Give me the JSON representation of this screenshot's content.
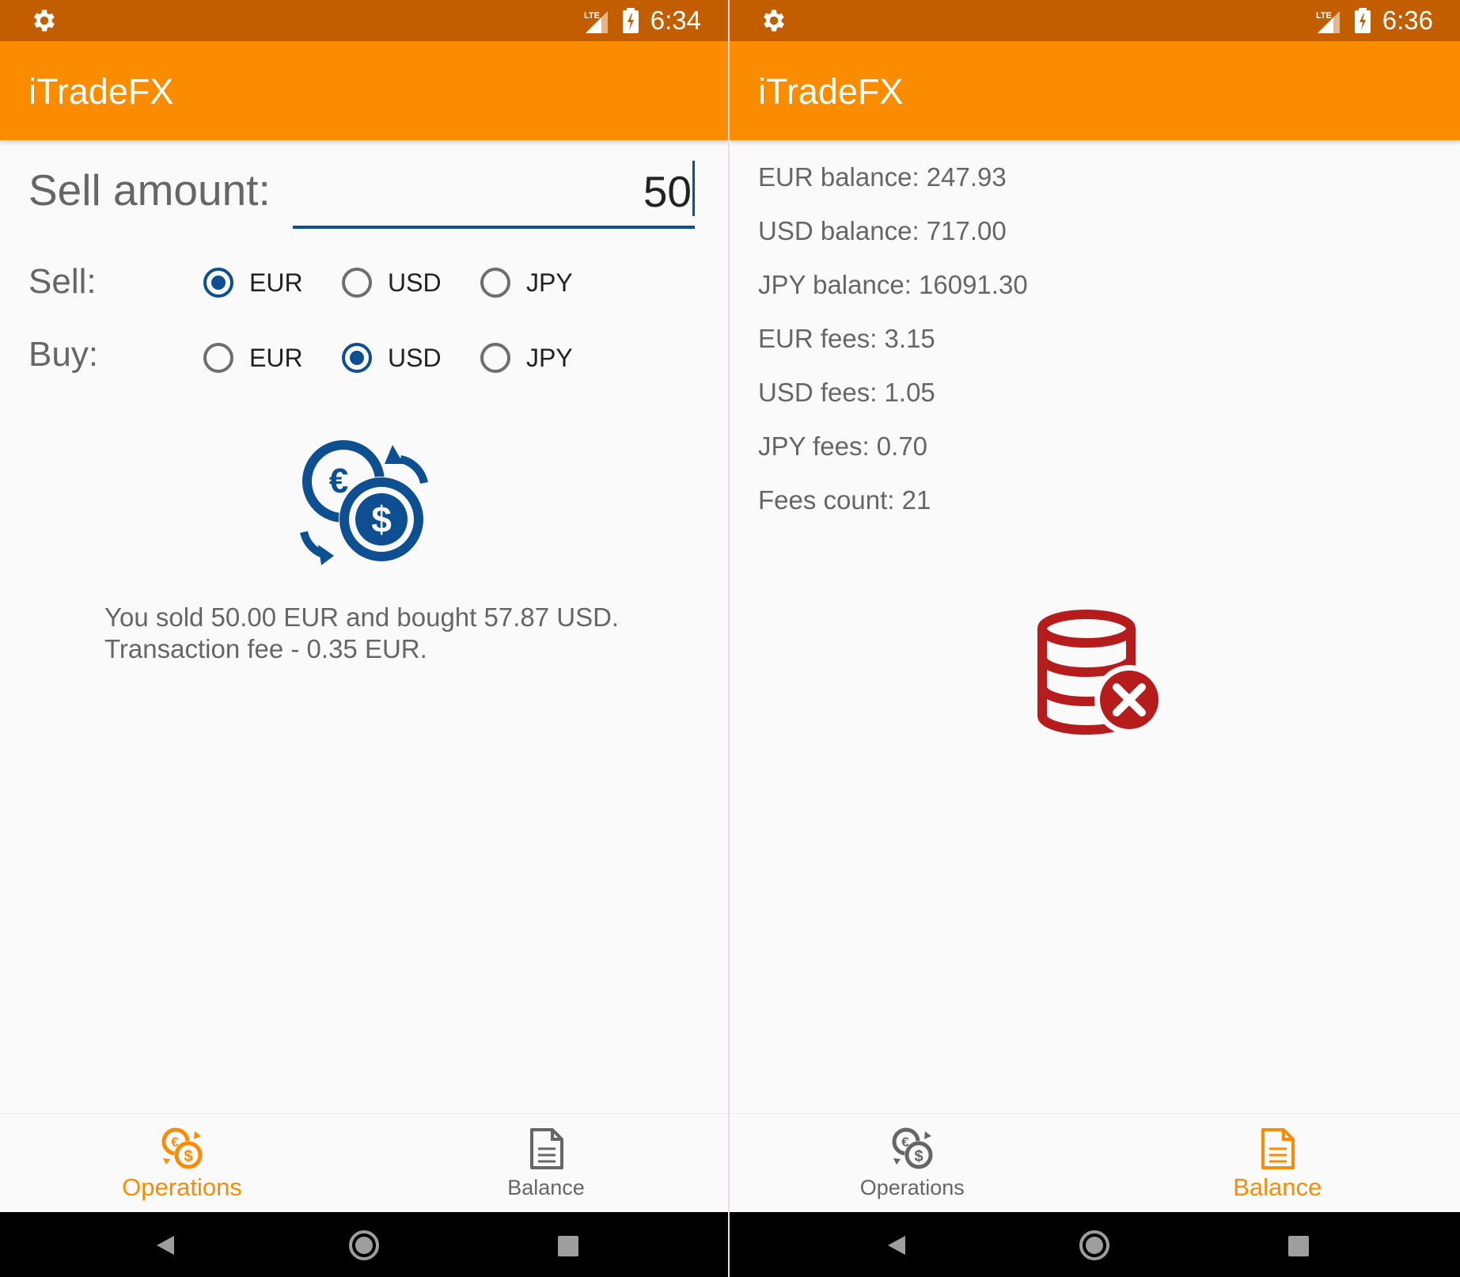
{
  "colors": {
    "status_bar": "#c25e00",
    "app_bar": "#fb8c00",
    "accent_blue": "#0d4f90",
    "error_red": "#b71c1c",
    "nav_active": "#fb8c00"
  },
  "left_screen": {
    "status_bar": {
      "time": "6:34",
      "network": "LTE",
      "icons": [
        "gear-icon",
        "signal-icon",
        "battery-charging-icon"
      ]
    },
    "app_title": "iTradeFX",
    "sell_amount": {
      "label": "Sell amount:",
      "value": "50"
    },
    "sell": {
      "label": "Sell:",
      "options": [
        "EUR",
        "USD",
        "JPY"
      ],
      "selected": "EUR"
    },
    "buy": {
      "label": "Buy:",
      "options": [
        "EUR",
        "USD",
        "JPY"
      ],
      "selected": "USD"
    },
    "main_icon": "currency-exchange-icon",
    "result": {
      "line1": "You sold 50.00 EUR and bought 57.87 USD.",
      "line2": "Transaction fee - 0.35 EUR."
    },
    "bottom_nav": {
      "items": [
        {
          "label": "Operations",
          "icon": "currency-exchange-icon",
          "active": true
        },
        {
          "label": "Balance",
          "icon": "document-icon",
          "active": false
        }
      ]
    }
  },
  "right_screen": {
    "status_bar": {
      "time": "6:36",
      "network": "LTE",
      "icons": [
        "gear-icon",
        "signal-icon",
        "battery-charging-icon"
      ]
    },
    "app_title": "iTradeFX",
    "balances": [
      "EUR balance: 247.93",
      "USD balance: 717.00",
      "JPY balance: 16091.30",
      "EUR fees: 3.15",
      "USD fees: 1.05",
      "JPY fees: 0.70",
      "Fees count: 21"
    ],
    "main_icon": "database-delete-icon",
    "bottom_nav": {
      "items": [
        {
          "label": "Operations",
          "icon": "currency-exchange-icon",
          "active": false
        },
        {
          "label": "Balance",
          "icon": "document-icon",
          "active": true
        }
      ]
    }
  },
  "system_nav": {
    "icons": [
      "back-icon",
      "home-icon",
      "recents-icon"
    ]
  }
}
